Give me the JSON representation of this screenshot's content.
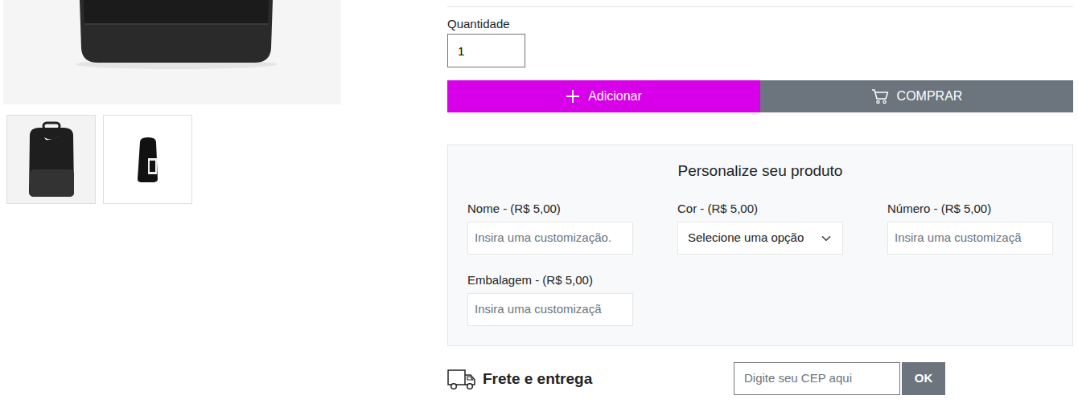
{
  "quantity": {
    "label": "Quantidade",
    "value": "1"
  },
  "buttons": [
    {
      "label": "Adicionar",
      "kind": "add"
    },
    {
      "label": "COMPRAR",
      "kind": "buy"
    }
  ],
  "customization": {
    "title": "Personalize seu produto",
    "fields": [
      {
        "label": "Nome - (R$ 5,00)",
        "kind": "text",
        "placeholder": "Insira uma customização."
      },
      {
        "label": "Cor - (R$ 5,00)",
        "kind": "select",
        "value": "Selecione uma opção"
      },
      {
        "label": "Número - (R$ 5,00)",
        "kind": "text",
        "placeholder": "Insira uma customizaçã"
      },
      {
        "label": "Embalagem - (R$ 5,00)",
        "kind": "text",
        "placeholder": "Insira uma customizaçã"
      }
    ]
  },
  "shipping": {
    "title": "Frete e entrega",
    "placeholder": "Digite seu CEP aqui",
    "button": "OK"
  }
}
